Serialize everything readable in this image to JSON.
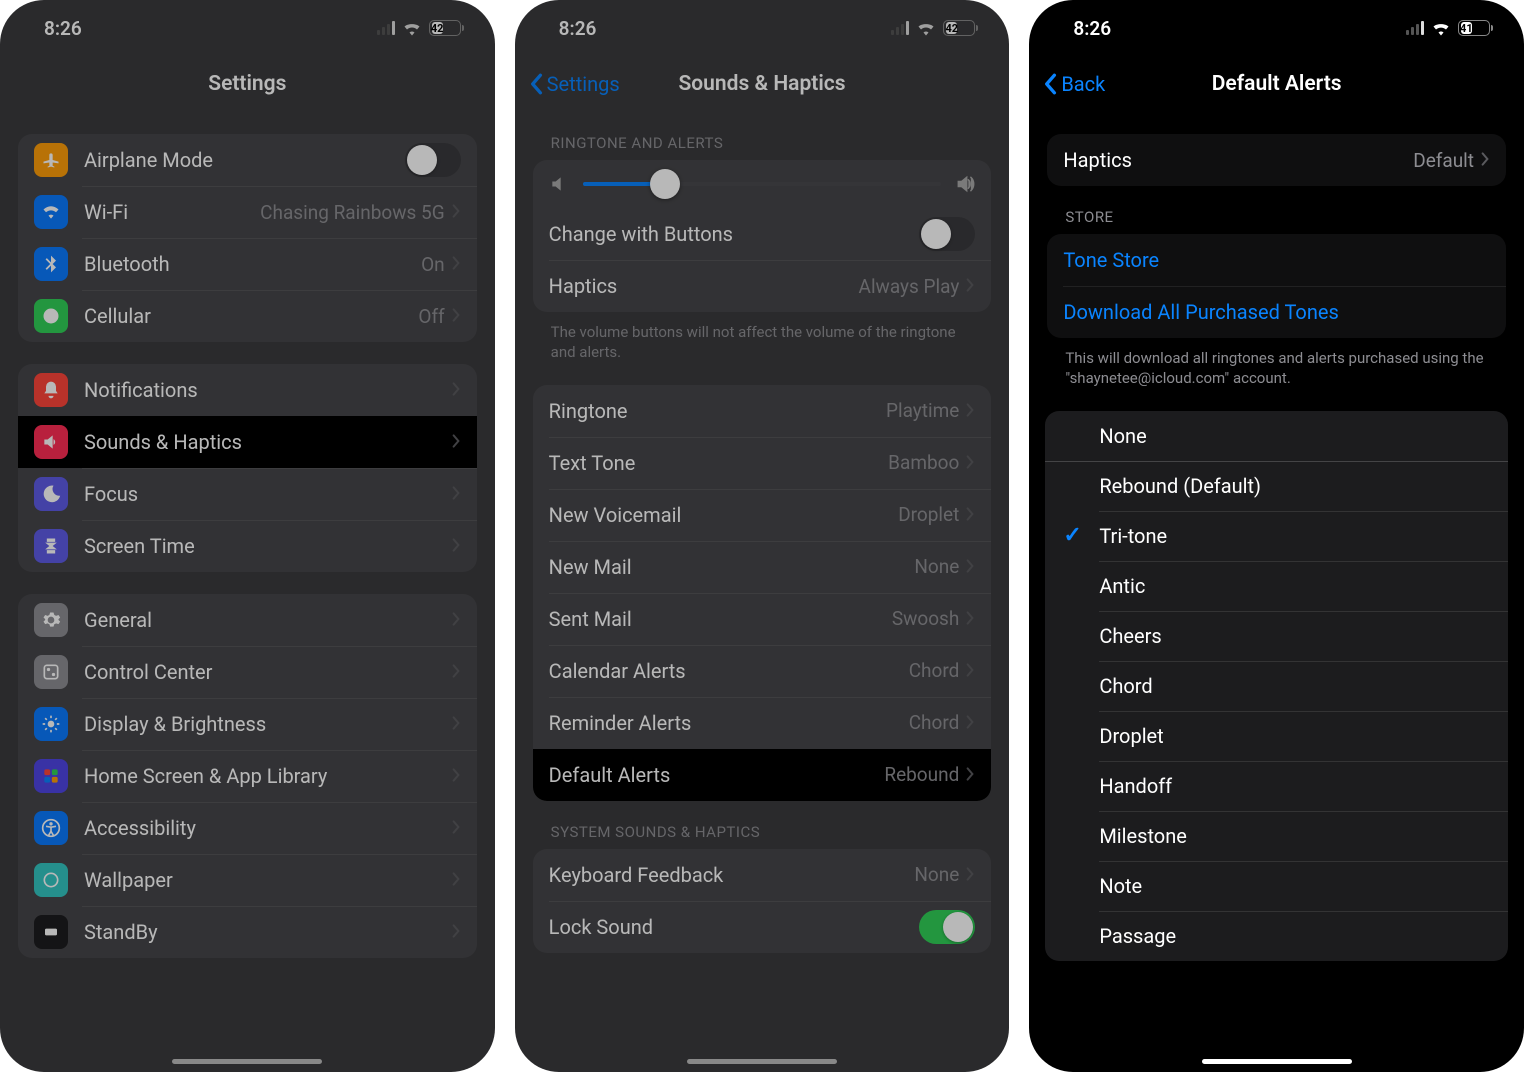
{
  "screens": {
    "settings": {
      "status": {
        "time": "8:26",
        "battery": "42"
      },
      "title": "Settings",
      "group1": [
        {
          "icon": "airplane",
          "color": "#ff9f0a",
          "label": "Airplane Mode",
          "toggle": false
        },
        {
          "icon": "wifi",
          "color": "#0a7aff",
          "label": "Wi-Fi",
          "value": "Chasing Rainbows 5G"
        },
        {
          "icon": "bluetooth",
          "color": "#0a7aff",
          "label": "Bluetooth",
          "value": "On"
        },
        {
          "icon": "cellular",
          "color": "#30d158",
          "label": "Cellular",
          "value": "Off"
        }
      ],
      "group2": [
        {
          "icon": "notifications",
          "color": "#ff453a",
          "label": "Notifications"
        },
        {
          "icon": "sounds",
          "color": "#ff2d55",
          "label": "Sounds & Haptics",
          "highlight": true
        },
        {
          "icon": "focus",
          "color": "#5e5ce6",
          "label": "Focus"
        },
        {
          "icon": "screentime",
          "color": "#5e5ce6",
          "label": "Screen Time"
        }
      ],
      "group3": [
        {
          "icon": "general",
          "color": "#8e8e93",
          "label": "General"
        },
        {
          "icon": "controlcenter",
          "color": "#8e8e93",
          "label": "Control Center"
        },
        {
          "icon": "display",
          "color": "#0a7aff",
          "label": "Display & Brightness"
        },
        {
          "icon": "homescreen",
          "color": "#4f46e5",
          "label": "Home Screen & App Library"
        },
        {
          "icon": "accessibility",
          "color": "#0a7aff",
          "label": "Accessibility"
        },
        {
          "icon": "wallpaper",
          "color": "#34c7c2",
          "label": "Wallpaper"
        },
        {
          "icon": "standby",
          "color": "#1c1c1e",
          "label": "StandBy"
        }
      ]
    },
    "sounds": {
      "status": {
        "time": "8:26",
        "battery": "42"
      },
      "back": "Settings",
      "title": "Sounds & Haptics",
      "section1_header": "RINGTONE AND ALERTS",
      "slider": 0.23,
      "change_buttons": {
        "label": "Change with Buttons",
        "on": false
      },
      "haptics_row": {
        "label": "Haptics",
        "value": "Always Play"
      },
      "section1_footer": "The volume buttons will not affect the volume of the ringtone and alerts.",
      "tones": [
        {
          "label": "Ringtone",
          "value": "Playtime"
        },
        {
          "label": "Text Tone",
          "value": "Bamboo"
        },
        {
          "label": "New Voicemail",
          "value": "Droplet"
        },
        {
          "label": "New Mail",
          "value": "None"
        },
        {
          "label": "Sent Mail",
          "value": "Swoosh"
        },
        {
          "label": "Calendar Alerts",
          "value": "Chord"
        },
        {
          "label": "Reminder Alerts",
          "value": "Chord"
        },
        {
          "label": "Default Alerts",
          "value": "Rebound",
          "highlight": true
        }
      ],
      "section3_header": "SYSTEM SOUNDS & HAPTICS",
      "system": [
        {
          "label": "Keyboard Feedback",
          "value": "None"
        },
        {
          "label": "Lock Sound",
          "toggle_on": true
        }
      ]
    },
    "alerts": {
      "status": {
        "time": "8:26",
        "battery": "41"
      },
      "back": "Back",
      "title": "Default Alerts",
      "haptics": {
        "label": "Haptics",
        "value": "Default"
      },
      "store_header": "STORE",
      "store_items": [
        "Tone Store",
        "Download All Purchased Tones"
      ],
      "store_footer": "This will download all ringtones and alerts purchased using the \"shaynetee@icloud.com\" account.",
      "tones": {
        "none": "None",
        "list": [
          {
            "label": "Rebound (Default)"
          },
          {
            "label": "Tri-tone",
            "checked": true
          },
          {
            "label": "Antic"
          },
          {
            "label": "Cheers"
          },
          {
            "label": "Chord"
          },
          {
            "label": "Droplet"
          },
          {
            "label": "Handoff"
          },
          {
            "label": "Milestone"
          },
          {
            "label": "Note"
          },
          {
            "label": "Passage"
          }
        ]
      }
    }
  }
}
